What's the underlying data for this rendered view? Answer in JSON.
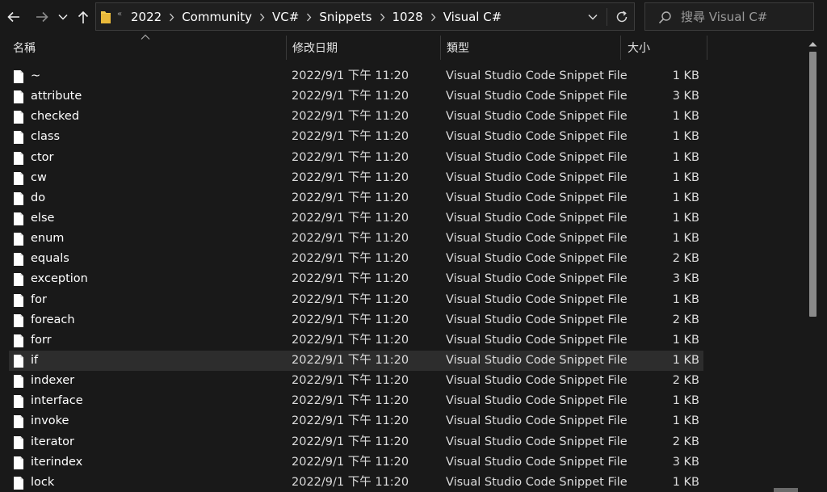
{
  "navigation": {
    "breadcrumb": [
      "2022",
      "Community",
      "VC#",
      "Snippets",
      "1028",
      "Visual C#"
    ],
    "overflow_glyph": "«"
  },
  "search": {
    "placeholder": "搜尋 Visual C#"
  },
  "columns": {
    "name": "名稱",
    "date": "修改日期",
    "type": "類型",
    "size": "大小"
  },
  "files": [
    {
      "name": "~",
      "date": "2022/9/1 下午 11:20",
      "type": "Visual Studio Code Snippet File",
      "size": "1 KB"
    },
    {
      "name": "attribute",
      "date": "2022/9/1 下午 11:20",
      "type": "Visual Studio Code Snippet File",
      "size": "3 KB"
    },
    {
      "name": "checked",
      "date": "2022/9/1 下午 11:20",
      "type": "Visual Studio Code Snippet File",
      "size": "1 KB"
    },
    {
      "name": "class",
      "date": "2022/9/1 下午 11:20",
      "type": "Visual Studio Code Snippet File",
      "size": "1 KB"
    },
    {
      "name": "ctor",
      "date": "2022/9/1 下午 11:20",
      "type": "Visual Studio Code Snippet File",
      "size": "1 KB"
    },
    {
      "name": "cw",
      "date": "2022/9/1 下午 11:20",
      "type": "Visual Studio Code Snippet File",
      "size": "1 KB"
    },
    {
      "name": "do",
      "date": "2022/9/1 下午 11:20",
      "type": "Visual Studio Code Snippet File",
      "size": "1 KB"
    },
    {
      "name": "else",
      "date": "2022/9/1 下午 11:20",
      "type": "Visual Studio Code Snippet File",
      "size": "1 KB"
    },
    {
      "name": "enum",
      "date": "2022/9/1 下午 11:20",
      "type": "Visual Studio Code Snippet File",
      "size": "1 KB"
    },
    {
      "name": "equals",
      "date": "2022/9/1 下午 11:20",
      "type": "Visual Studio Code Snippet File",
      "size": "2 KB"
    },
    {
      "name": "exception",
      "date": "2022/9/1 下午 11:20",
      "type": "Visual Studio Code Snippet File",
      "size": "3 KB"
    },
    {
      "name": "for",
      "date": "2022/9/1 下午 11:20",
      "type": "Visual Studio Code Snippet File",
      "size": "1 KB"
    },
    {
      "name": "foreach",
      "date": "2022/9/1 下午 11:20",
      "type": "Visual Studio Code Snippet File",
      "size": "2 KB"
    },
    {
      "name": "forr",
      "date": "2022/9/1 下午 11:20",
      "type": "Visual Studio Code Snippet File",
      "size": "1 KB"
    },
    {
      "name": "if",
      "date": "2022/9/1 下午 11:20",
      "type": "Visual Studio Code Snippet File",
      "size": "1 KB",
      "selected": true
    },
    {
      "name": "indexer",
      "date": "2022/9/1 下午 11:20",
      "type": "Visual Studio Code Snippet File",
      "size": "2 KB"
    },
    {
      "name": "interface",
      "date": "2022/9/1 下午 11:20",
      "type": "Visual Studio Code Snippet File",
      "size": "1 KB"
    },
    {
      "name": "invoke",
      "date": "2022/9/1 下午 11:20",
      "type": "Visual Studio Code Snippet File",
      "size": "1 KB"
    },
    {
      "name": "iterator",
      "date": "2022/9/1 下午 11:20",
      "type": "Visual Studio Code Snippet File",
      "size": "2 KB"
    },
    {
      "name": "iterindex",
      "date": "2022/9/1 下午 11:20",
      "type": "Visual Studio Code Snippet File",
      "size": "3 KB"
    },
    {
      "name": "lock",
      "date": "2022/9/1 下午 11:20",
      "type": "Visual Studio Code Snippet File",
      "size": "1 KB"
    }
  ],
  "icons": {
    "back": "arrow-left-icon",
    "forward": "arrow-right-icon",
    "recent": "chevron-down-icon",
    "up": "arrow-up-icon",
    "folder": "folder-icon",
    "refresh": "refresh-icon",
    "search": "search-icon",
    "file": "file-icon"
  },
  "colors": {
    "background": "#191919",
    "selected_row": "#2d2d2d",
    "folder": "#f2c94c",
    "scroll_thumb": "#8a8a8a"
  }
}
